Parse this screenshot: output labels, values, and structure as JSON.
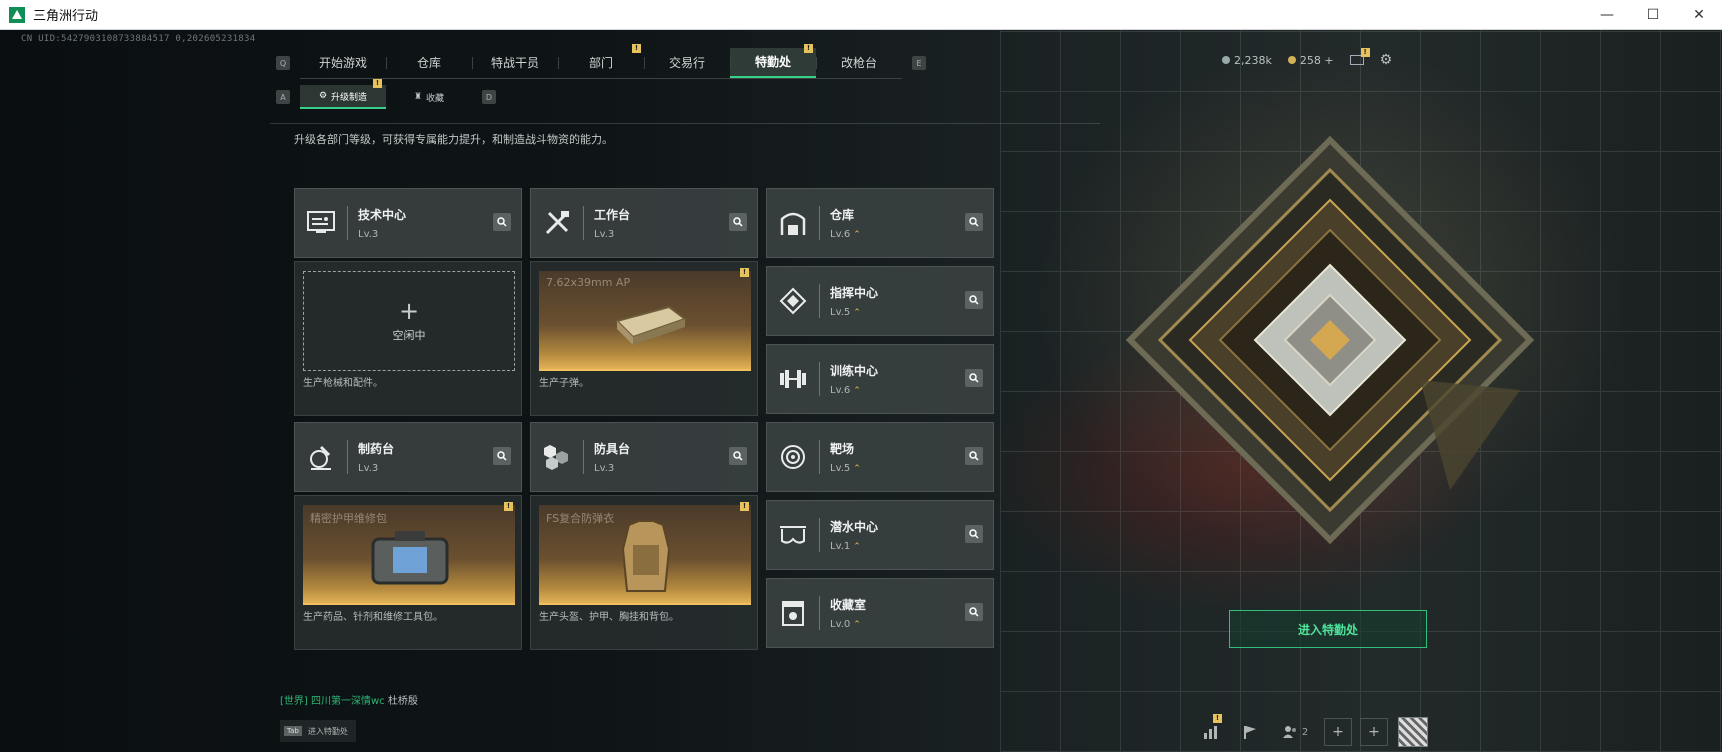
{
  "window": {
    "title": "三角洲行动",
    "min": "—",
    "max": "☐",
    "close": "✕"
  },
  "uid": "CN UID:5427903108733884517 0,202605231834",
  "nav": {
    "left_key": "Q",
    "right_key": "E",
    "tabs": [
      {
        "label": "开始游戏",
        "active": false
      },
      {
        "label": "仓库",
        "active": false
      },
      {
        "label": "特战干员",
        "active": false
      },
      {
        "label": "部门",
        "active": false,
        "badge": "!"
      },
      {
        "label": "交易行",
        "active": false
      },
      {
        "label": "特勤处",
        "active": true,
        "badge": "!"
      },
      {
        "label": "改枪台",
        "active": false
      }
    ]
  },
  "subnav": {
    "left_key": "A",
    "right_key": "D",
    "tabs": [
      {
        "label": "升级制造",
        "active": true,
        "icon": "upgrade-icon",
        "badge": "!"
      },
      {
        "label": "收藏",
        "active": false,
        "icon": "trophy-icon"
      }
    ]
  },
  "description": "升级各部门等级，可获得专属能力提升，和制造战斗物资的能力。",
  "currency": {
    "coins": "2,238k",
    "tickets": "258",
    "plus": "+"
  },
  "facilities": {
    "tech_center": {
      "name": "技术中心",
      "level": "Lv.3",
      "icon": "circuit-icon"
    },
    "workbench": {
      "name": "工作台",
      "level": "Lv.3",
      "icon": "tools-icon"
    },
    "pharmacy": {
      "name": "制药台",
      "level": "Lv.3",
      "icon": "microscope-icon"
    },
    "armor_bench": {
      "name": "防具台",
      "level": "Lv.3",
      "icon": "armor-blocks-icon"
    },
    "warehouse": {
      "name": "仓库",
      "level": "Lv.6",
      "icon": "warehouse-icon"
    },
    "command": {
      "name": "指挥中心",
      "level": "Lv.5",
      "icon": "command-icon"
    },
    "training": {
      "name": "训练中心",
      "level": "Lv.6",
      "icon": "dumbbell-icon"
    },
    "range": {
      "name": "靶场",
      "level": "Lv.5",
      "icon": "target-icon"
    },
    "diving": {
      "name": "潜水中心",
      "level": "Lv.1",
      "icon": "diving-mask-icon"
    },
    "collection": {
      "name": "收藏室",
      "level": "Lv.0",
      "icon": "collection-icon"
    }
  },
  "production": {
    "tech_center": {
      "state": "空闲中",
      "plus": "+",
      "desc": "生产枪械和配件。"
    },
    "workbench": {
      "item": "7.62x39mm AP",
      "desc": "生产子弹。"
    },
    "pharmacy": {
      "item": "精密护甲维修包",
      "desc": "生产药品、针剂和维修工具包。"
    },
    "armor_bench": {
      "item": "FS复合防弹衣",
      "desc": "生产头盔、护甲、胸挂和背包。"
    }
  },
  "enter_button": "进入特勤处",
  "chat": {
    "channel": "[世界]",
    "text": "四川第一深情wc",
    "sender": "杜桥殷"
  },
  "tab_hint": {
    "key": "Tab",
    "label": "进入特勤处"
  },
  "bottom_bar": {
    "friends_count": "2",
    "badge": "!"
  },
  "colors": {
    "accent": "#36d08a",
    "gold": "#e5b84a",
    "card": "#3a4040"
  }
}
